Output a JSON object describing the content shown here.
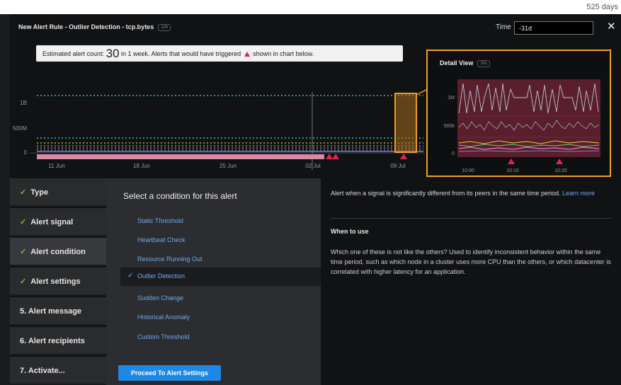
{
  "top_strip": {
    "days_text": "525 days"
  },
  "header": {
    "title": "New Alert Rule - Outlier Detection - tcp.bytes",
    "title_badge": "12h",
    "time_label": "Time",
    "time_value": "-31d",
    "close_icon": "close-icon"
  },
  "estimate": {
    "prefix": "Estimated alert count:",
    "count": "30",
    "suffix": "in 1 week. Alerts that would have triggered",
    "suffix2": "shown in chart below."
  },
  "main_chart": {
    "y_ticks": [
      "1B",
      "500M",
      "0"
    ],
    "x_ticks": [
      "11 Jun",
      "18 Jun",
      "25 Jun",
      "02 Jul",
      "09 Jul"
    ],
    "alert_color": "#e0254a",
    "highlight_color": "#f0a020"
  },
  "detail_view": {
    "title": "Detail View",
    "badge": "30s",
    "y_ticks": [
      "1M",
      "500k",
      "0"
    ],
    "x_ticks": [
      "10:00",
      "10:10",
      "10:20"
    ]
  },
  "steps": [
    {
      "label": "Type",
      "done": true
    },
    {
      "label": "Alert signal",
      "done": true
    },
    {
      "label": "Alert condition",
      "done": true
    },
    {
      "label": "Alert settings",
      "done": true
    },
    {
      "label": "5.  Alert message",
      "done": false
    },
    {
      "label": "6.  Alert recipients",
      "done": false
    },
    {
      "label": "7.  Activate...",
      "done": false
    }
  ],
  "conditions": {
    "title": "Select a condition for this alert",
    "items": [
      "Static Threshold",
      "Heartbeat Check",
      "Resource Running Out",
      "Outlier Detection",
      "Sudden Change",
      "Historical Anomaly",
      "Custom Threshold"
    ],
    "selected": "Outlier Detection",
    "proceed_label": "Proceed To Alert Settings"
  },
  "info": {
    "description": "Alert when a signal is significantly different from its peers in the same time period.",
    "learn_more": "Learn more",
    "when_title": "When to use",
    "when_body": "Which one of these is not like the others? Used to identify inconsistent behavior within the same time period, such as which node in a cluster uses more CPU than the others, or which datacenter is correlated with higher latency for an application."
  }
}
